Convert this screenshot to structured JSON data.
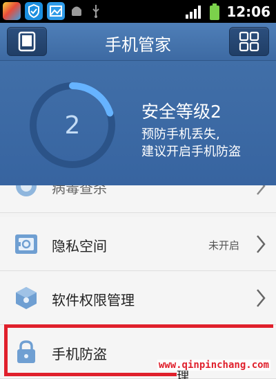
{
  "statusbar": {
    "time": "12:06"
  },
  "header": {
    "title": "手机管家",
    "left_icon": "phone-icon",
    "right_icon": "grid-icon"
  },
  "hero": {
    "level_number": "2",
    "title": "安全等级2",
    "line1": "预防手机丢失,",
    "line2": "建议开启手机防盗",
    "ring_progress": 0.2
  },
  "list": {
    "items": [
      {
        "label": "病毒查杀",
        "icon": "virus-scan-icon",
        "status": ""
      },
      {
        "label": "隐私空间",
        "icon": "safe-box-icon",
        "status": "未开启"
      },
      {
        "label": "软件权限管理",
        "icon": "cube-icon",
        "status": ""
      },
      {
        "label": "手机防盗",
        "icon": "lock-icon",
        "status": ""
      }
    ]
  },
  "watermark": "www.qinpinchang.com",
  "stray_text": "理",
  "colors": {
    "header": "#4f7fb8",
    "ring": "#66b3ff",
    "highlight": "#e0202c"
  }
}
